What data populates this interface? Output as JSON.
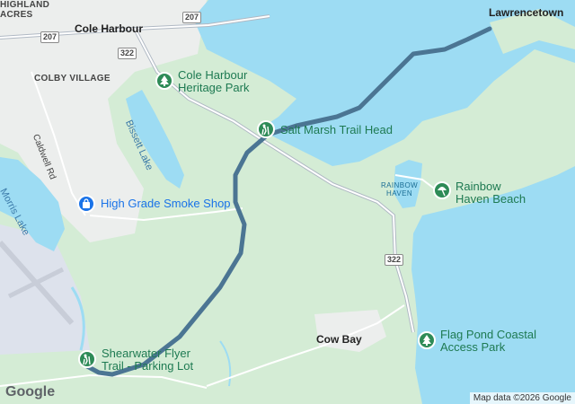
{
  "map": {
    "places": {
      "highland_acres": "HIGHLAND\nACRES",
      "cole_harbour": "Cole Harbour",
      "colby_village": "COLBY VILLAGE",
      "lawrencetown": "Lawrencetown",
      "cow_bay": "Cow Bay"
    },
    "roads": {
      "caldwell_rd": "Caldwell Rd",
      "shield_207_a": "207",
      "shield_207_b": "207",
      "shield_322_a": "322",
      "shield_322_b": "322"
    },
    "water": {
      "bissett_lake": "Bissett Lake",
      "morris_lake": "Morris Lake",
      "rainbow_haven": "RAINBOW\nHAVEN"
    },
    "pois": {
      "cole_harbour_park": "Cole Harbour\nHeritage Park",
      "salt_marsh": "Salt Marsh Trail Head",
      "smoke_shop": "High Grade Smoke Shop",
      "rainbow_beach": "Rainbow\nHaven Beach",
      "flag_pond": "Flag Pond Coastal\nAccess Park",
      "shearwater": "Shearwater Flyer\nTrail - Parking Lot"
    },
    "brand": "Google",
    "attribution": "Map data ©2026 Google"
  },
  "colors": {
    "water": "#9ddcf3",
    "land": "#d4ecd5",
    "route": "#4b7593",
    "poi_green": "#2e8b57",
    "poi_blue": "#1a73e8"
  }
}
